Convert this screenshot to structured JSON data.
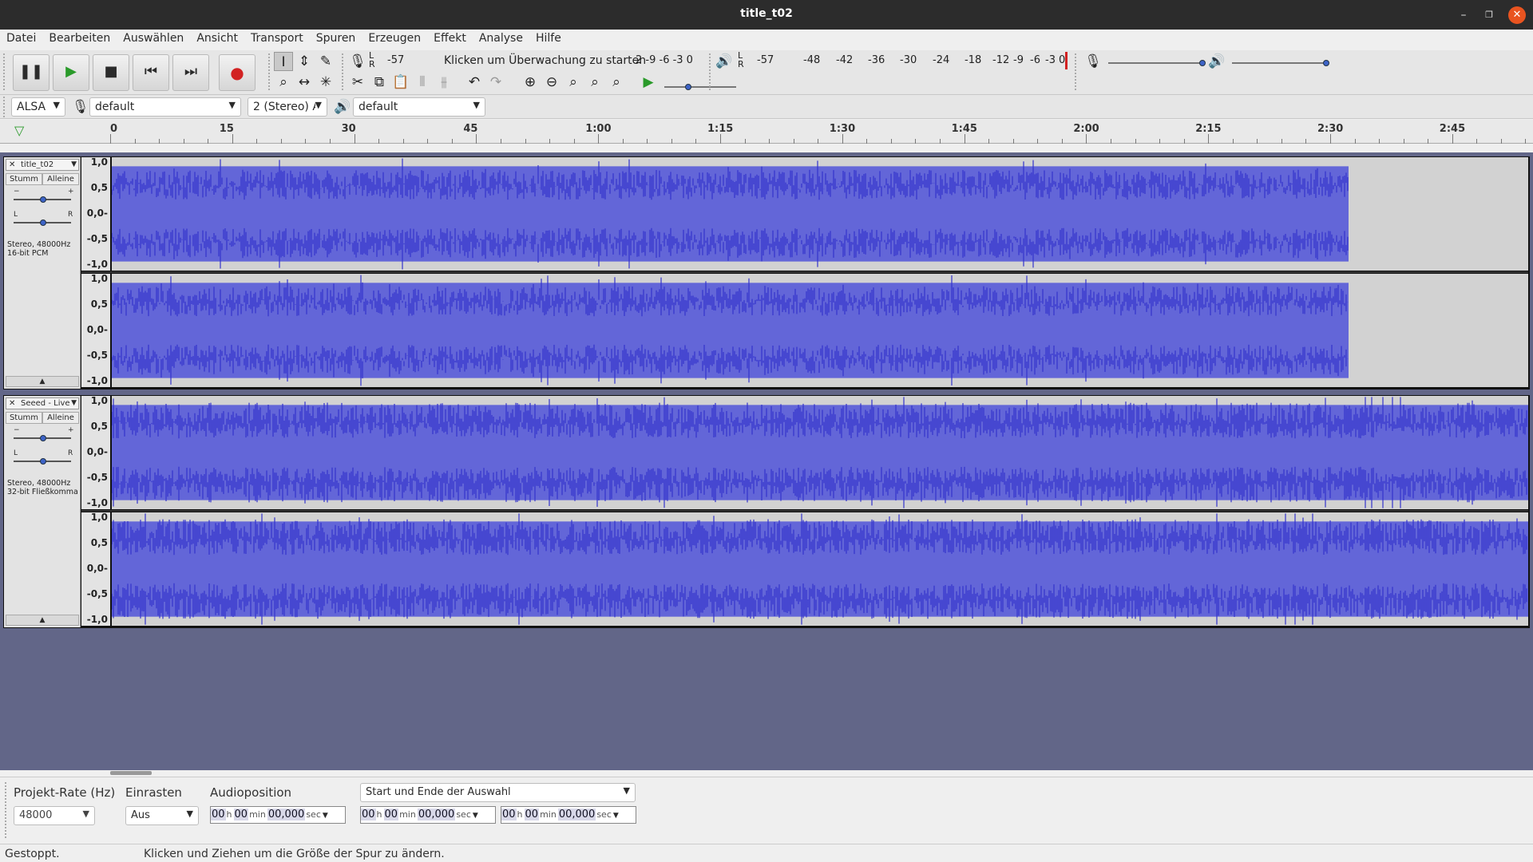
{
  "window": {
    "title": "title_t02"
  },
  "menu": [
    "Datei",
    "Bearbeiten",
    "Auswählen",
    "Ansicht",
    "Transport",
    "Spuren",
    "Erzeugen",
    "Effekt",
    "Analyse",
    "Hilfe"
  ],
  "transport": {
    "pause": "pause-icon",
    "play": "play-icon",
    "stop": "stop-icon",
    "skip_start": "skip-start-icon",
    "skip_end": "skip-end-icon",
    "record": "record-icon"
  },
  "rec_meter": {
    "lr": "L\nR",
    "scale_left": "-57",
    "prompt": "Klicken um Überwachung zu starten",
    "scale_right": "2 -9 -6 -3 0"
  },
  "play_meter": {
    "scale": [
      "-57",
      "-48",
      "-42",
      "-36",
      "-30",
      "-24",
      "-18",
      "-12",
      "-9",
      "-6",
      "-3",
      "0"
    ]
  },
  "device": {
    "host": "ALSA",
    "rec_device": "default",
    "channels": "2 (Stereo) A",
    "play_device": "default"
  },
  "ruler": [
    "0",
    "15",
    "30",
    "45",
    "1:00",
    "1:15",
    "1:30",
    "1:45",
    "2:00",
    "2:15",
    "2:30",
    "2:45"
  ],
  "vscale": [
    "1,0",
    "0,5",
    "0,0-",
    "-0,5",
    "-1,0"
  ],
  "tracks": [
    {
      "name": "title_t02",
      "mute": "Stumm",
      "solo": "Alleine",
      "info1": "Stereo, 48000Hz",
      "info2": "16-bit PCM",
      "end_fraction": 0.873
    },
    {
      "name": "Seeed - Live",
      "mute": "Stumm",
      "solo": "Alleine",
      "info1": "Stereo, 48000Hz",
      "info2": "32-bit Fließkomma",
      "end_fraction": 1.0
    }
  ],
  "selection": {
    "rate_label": "Projekt-Rate (Hz)",
    "rate_value": "48000",
    "snap_label": "Einrasten",
    "snap_value": "Aus",
    "pos_label": "Audioposition",
    "mode_value": "Start und Ende der Auswahl",
    "times": {
      "h": "00",
      "h_unit": "h",
      "m": "00",
      "m_unit": "min",
      "s": "00,000",
      "s_unit": "sec"
    }
  },
  "status": {
    "state": "Gestoppt.",
    "hint": "Klicken und Ziehen um die Größe der Spur zu ändern."
  },
  "colors": {
    "wave": "#6366d8",
    "wave_dark": "#3333cc",
    "track_bg": "#626688",
    "record": "#d22222",
    "close": "#e95420"
  }
}
